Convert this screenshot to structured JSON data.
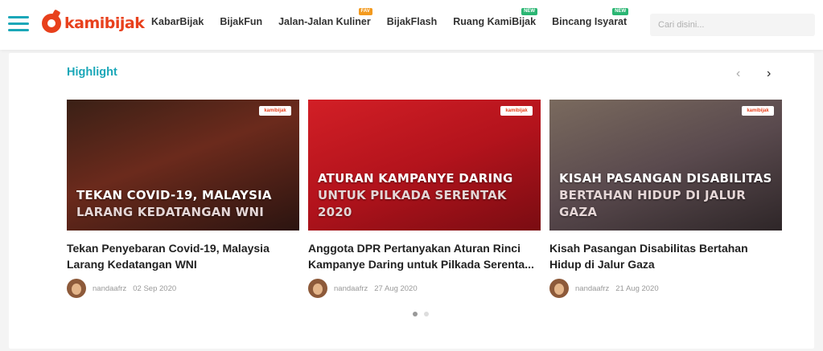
{
  "brand": {
    "name": "kamibijak",
    "accent": "#1aa7b8",
    "logo_color": "#e8401c"
  },
  "nav": {
    "items": [
      {
        "label": "KabarBijak",
        "badge": ""
      },
      {
        "label": "BijakFun",
        "badge": ""
      },
      {
        "label": "Jalan-Jalan Kuliner",
        "badge": "FAV"
      },
      {
        "label": "BijakFlash",
        "badge": ""
      },
      {
        "label": "Ruang KamiBijak",
        "badge": "NEW"
      },
      {
        "label": "Bincang Isyarat",
        "badge": "NEW"
      }
    ]
  },
  "search": {
    "placeholder": "Cari disini..."
  },
  "highlight": {
    "title": "Highlight",
    "prev_icon": "chevron-left-icon",
    "next_icon": "chevron-right-icon",
    "cards": [
      {
        "thumb_line1": "TEKAN COVID-19, MALAYSIA",
        "thumb_line2": "LARANG KEDATANGAN WNI",
        "title": "Tekan Penyebaran Covid-19, Malaysia Larang Kedatangan WNI",
        "author": "nandaafrz",
        "date": "02 Sep 2020",
        "thumb_color": "#6b2a1c"
      },
      {
        "thumb_line1": "ATURAN KAMPANYE DARING",
        "thumb_line2": "UNTUK PILKADA SERENTAK 2020",
        "title": "Anggota DPR Pertanyakan Aturan Rinci Kampanye Daring untuk Pilkada Serenta...",
        "author": "nandaafrz",
        "date": "27 Aug 2020",
        "thumb_color": "#b3131c"
      },
      {
        "thumb_line1": "KISAH PASANGAN DISABILITAS",
        "thumb_line2": "BERTAHAN HIDUP DI JALUR GAZA",
        "title": "Kisah Pasangan Disabilitas Bertahan Hidup di Jalur Gaza",
        "author": "nandaafrz",
        "date": "21 Aug 2020",
        "thumb_color": "#5a4a4e"
      }
    ],
    "thumb_logo": "kamibijak",
    "dots": {
      "count": 2,
      "active": 1
    }
  }
}
